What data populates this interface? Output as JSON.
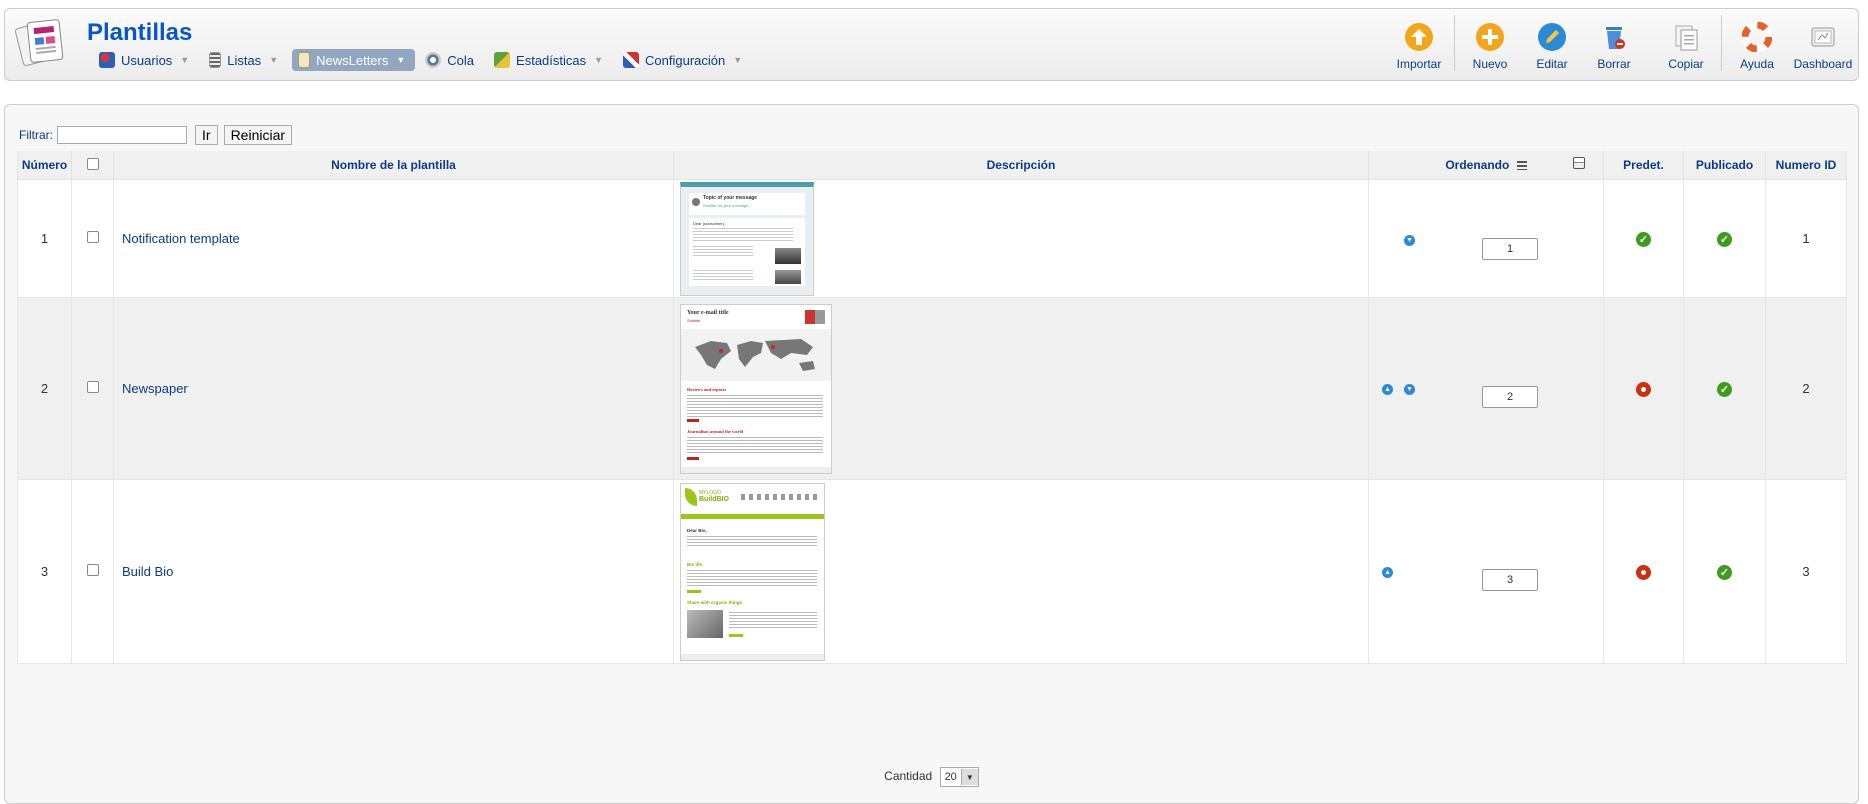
{
  "header": {
    "title": "Plantillas",
    "menu": [
      {
        "label": "Usuarios",
        "icon": "users-icon",
        "has_caret": true,
        "active": false
      },
      {
        "label": "Listas",
        "icon": "list-icon",
        "has_caret": true,
        "active": false
      },
      {
        "label": "NewsLetters",
        "icon": "newsletter-icon",
        "has_caret": true,
        "active": true
      },
      {
        "label": "Cola",
        "icon": "queue-icon",
        "has_caret": false,
        "active": false
      },
      {
        "label": "Estadísticas",
        "icon": "stats-icon",
        "has_caret": true,
        "active": false
      },
      {
        "label": "Configuración",
        "icon": "config-icon",
        "has_caret": true,
        "active": false
      }
    ],
    "toolbar": {
      "import": "Importar",
      "new": "Nuevo",
      "edit": "Editar",
      "delete": "Borrar",
      "copy": "Copiar",
      "help": "Ayuda",
      "dashboard": "Dashboard"
    }
  },
  "filter": {
    "label": "Filtrar:",
    "value": "",
    "go_label": "Ir",
    "reset_label": "Reiniciar"
  },
  "table": {
    "columns": {
      "number": "Número",
      "name": "Nombre de la plantilla",
      "description": "Descripción",
      "ordering": "Ordenando",
      "default": "Predet.",
      "published": "Publicado",
      "id": "Numero ID"
    },
    "rows": [
      {
        "number": "1",
        "name": "Notification template",
        "thumb": "notification",
        "up": false,
        "down": true,
        "order": "1",
        "default": true,
        "published": true,
        "id": "1"
      },
      {
        "number": "2",
        "name": "Newspaper",
        "thumb": "newspaper",
        "up": true,
        "down": true,
        "order": "2",
        "default": false,
        "published": true,
        "id": "2"
      },
      {
        "number": "3",
        "name": "Build Bio",
        "thumb": "buildbio",
        "up": true,
        "down": false,
        "order": "3",
        "default": false,
        "published": true,
        "id": "3"
      }
    ]
  },
  "thumbnails": {
    "notification": {
      "title": "Topic of your message",
      "subtitle": "Subtitle for your message",
      "greeting": "Dear {subscriber},"
    },
    "newspaper": {
      "title": "Your e-mail title",
      "subtitle": "Subtitle",
      "section1": "Reviews and reports",
      "section2": "Journalism around the world"
    },
    "buildbio": {
      "logo": "MYLOGO",
      "brand": "BuildBIO",
      "heading1": "Dear Bio,",
      "heading2": "Bio life",
      "heading3": "Share with organic things"
    }
  },
  "pagination": {
    "label": "Cantidad",
    "value": "20"
  },
  "colors": {
    "link": "#0b3b86",
    "active_menu": "#90a6c1",
    "ok": "#3c9c1e",
    "off": "#c8320e",
    "arrow": "#2a89d8"
  }
}
